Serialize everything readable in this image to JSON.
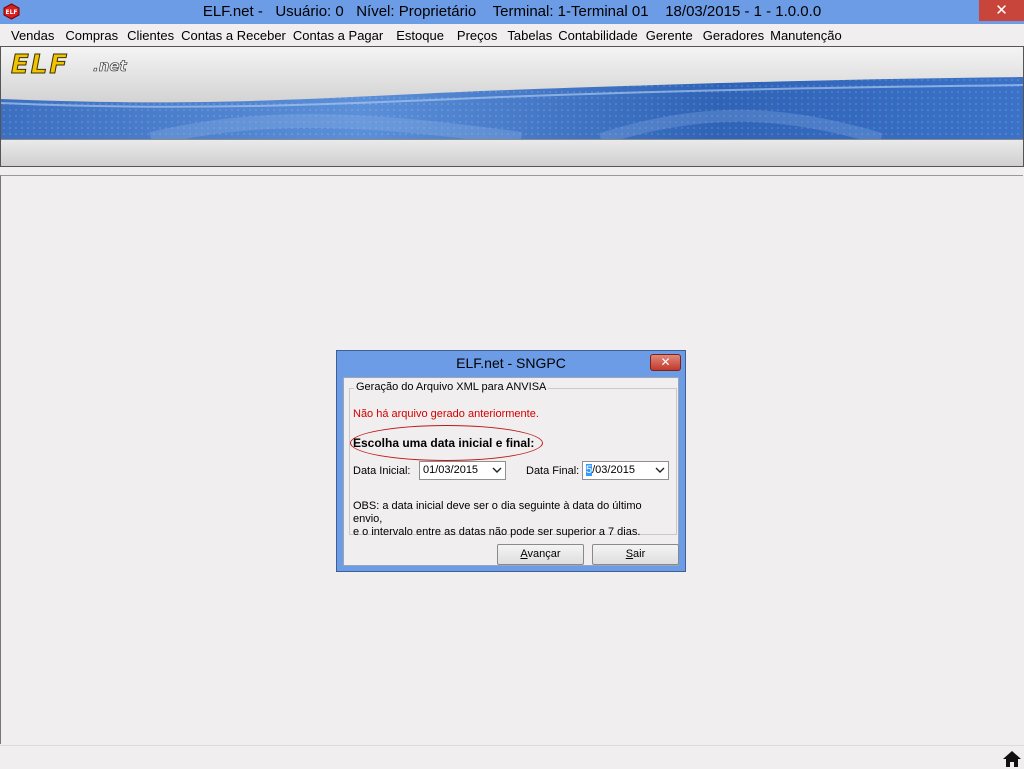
{
  "window": {
    "title": "ELF.net -   Usuário: 0   Nível: Proprietário    Terminal: 1-Terminal 01    18/03/2015 - 1 - 1.0.0.0",
    "close_label": "✕",
    "icon": "elf-app-icon"
  },
  "menu": {
    "items": [
      {
        "label": "Vendas"
      },
      {
        "label": "Compras"
      },
      {
        "label": "Clientes"
      },
      {
        "label": "Contas a Receber"
      },
      {
        "label": "Contas a Pagar"
      },
      {
        "label": "Estoque"
      },
      {
        "label": "Preços"
      },
      {
        "label": "Tabelas"
      },
      {
        "label": "Contabilidade"
      },
      {
        "label": "Gerente"
      },
      {
        "label": "Geradores"
      },
      {
        "label": "Manutenção"
      }
    ]
  },
  "banner": {
    "logo_text": "ELF",
    "logo_suffix": ".net"
  },
  "dialog": {
    "title": "ELF.net - SNGPC",
    "close_label": "✕",
    "group_title": "Geração do Arquivo XML para ANVISA",
    "warning": "Não há arquivo gerado anteriormente.",
    "instruction": "Escolha uma data inicial e final:",
    "start_label": "Data Inicial:",
    "start_value": "01/03/2015",
    "end_label": "Data Final:",
    "end_value_selected": "5",
    "end_value_rest": "/03/2015",
    "obs_line1": "OBS: a data inicial deve ser o dia seguinte à data do último envio,",
    "obs_line2": "e o intervalo entre as datas não pode ser superior a 7 dias.",
    "next_button_prefix": "",
    "next_button_underlined": "A",
    "next_button_rest": "vançar",
    "exit_button_prefix": "",
    "exit_button_underlined": "S",
    "exit_button_rest": "air"
  },
  "colors": {
    "titlebar": "#6c9ce6",
    "close": "#c7453a",
    "warning_text": "#d40000",
    "highlight": "#3399ff"
  },
  "icons": {
    "home": "home-icon",
    "dropdown": "chevron-down-icon"
  }
}
